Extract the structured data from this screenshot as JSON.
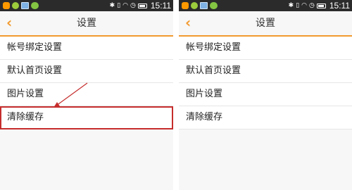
{
  "status_bar": {
    "time": "15:11",
    "icons": [
      "orange-notification-icon",
      "green-notification-icon",
      "image-notification-icon",
      "wechat-icon",
      "bluetooth-icon",
      "vibrate-icon",
      "wifi-icon",
      "alarm-icon",
      "battery-icon"
    ]
  },
  "header": {
    "title": "设置",
    "back_icon": "chevron-left-icon"
  },
  "settings_items": [
    {
      "label": "帐号绑定设置"
    },
    {
      "label": "默认首页设置"
    },
    {
      "label": "图片设置"
    },
    {
      "label": "清除缓存"
    }
  ],
  "colors": {
    "accent": "#f29a2e",
    "highlight": "#c62d2d",
    "status_bar_bg": "#2b2b2b"
  }
}
